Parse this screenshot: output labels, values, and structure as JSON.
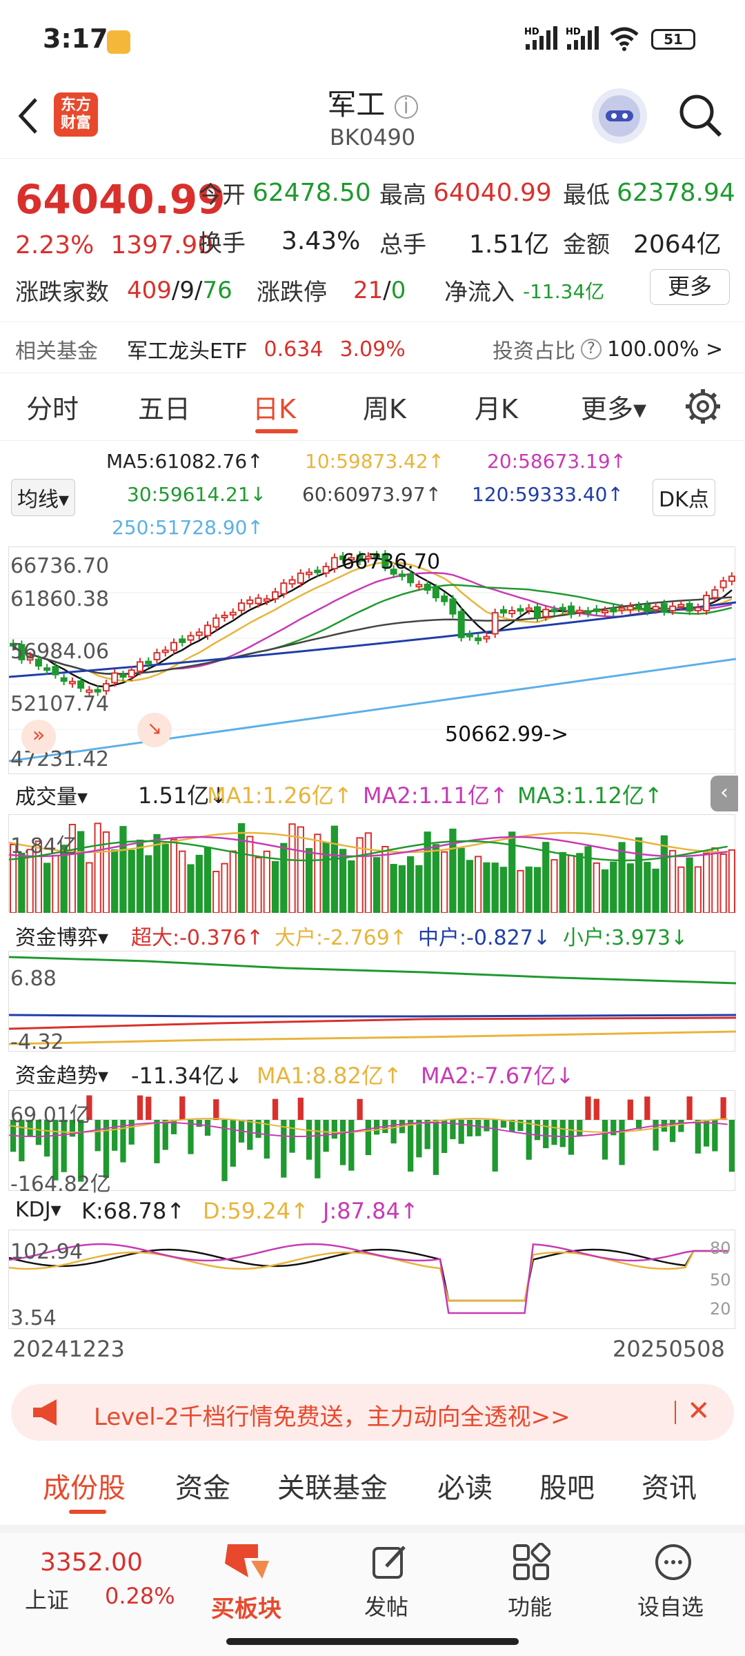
{
  "status": {
    "time": "3:17",
    "battery": "51",
    "net1": "HD",
    "net2": "HD"
  },
  "header": {
    "title": "军工",
    "code": "BK0490",
    "logo_line1": "东方",
    "logo_line2": "财富"
  },
  "quote": {
    "price": "64040.99",
    "change_pct": "2.23%",
    "change": "1397.90",
    "open_label": "今开",
    "open": "62478.50",
    "high_label": "最高",
    "high": "64040.99",
    "low_label": "最低",
    "low": "62378.94",
    "turnover_label": "换手",
    "turnover": "3.43%",
    "volume_label": "总手",
    "volume": "1.51亿",
    "amount_label": "金额",
    "amount": "2064亿",
    "advdec_label": "涨跌家数",
    "adv": "409",
    "sep1": "/",
    "flat": "9",
    "sep2": "/",
    "dec": "76",
    "limit_label": "涨跌停",
    "limit_up": "21",
    "sep3": "/",
    "limit_down": "0",
    "netflow_label": "净流入",
    "netflow": "-11.34亿",
    "more_btn": "更多"
  },
  "fund": {
    "label": "相关基金",
    "name": "军工龙头ETF",
    "price": "0.634",
    "pct": "3.09%",
    "ratio_label": "投资占比",
    "ratio": "100.00% >"
  },
  "tabs": [
    "分时",
    "五日",
    "日K",
    "周K",
    "月K",
    "更多▾"
  ],
  "ma": {
    "ma5": "MA5:61082.76↑",
    "ma10": "10:59873.42↑",
    "ma20": "20:58673.19↑",
    "ma30": "30:59614.21↓",
    "ma60": "60:60973.97↑",
    "ma120": "120:59333.40↑",
    "ma250": "250:51728.90↑",
    "junxian": "均线▾",
    "dk": "DK点"
  },
  "kline_axis": {
    "y1": "66736.70",
    "y2": "61860.38",
    "y3": "56984.06",
    "y4": "52107.74",
    "y5": "47231.42",
    "peak": "66736.70",
    "low": "50662.99->"
  },
  "vol": {
    "label": "成交量▾",
    "value": "1.51亿↓",
    "ma1": "MA1:1.26亿↑",
    "ma2": "MA2:1.11亿↑",
    "ma3": "MA3:1.12亿↑",
    "axis": "1.84亿"
  },
  "capital": {
    "label": "资金博弈▾",
    "super": "超大:-0.376↑",
    "big": "大户:-2.769↑",
    "mid": "中户:-0.827↓",
    "small": "小户:3.973↓",
    "top": "6.88",
    "bottom": "-4.32"
  },
  "trend": {
    "label": "资金趋势▾",
    "value": "-11.34亿↓",
    "ma1": "MA1:8.82亿↑",
    "ma2": "MA2:-7.67亿↓",
    "top": "69.01亿",
    "bottom": "-164.82亿"
  },
  "kdj": {
    "label": "KDJ▾",
    "k": "K:68.78↑",
    "d": "D:59.24↑",
    "j": "J:87.84↑",
    "top": "102.94",
    "bottom": "3.54",
    "r80": "80",
    "r50": "50",
    "r20": "20"
  },
  "dates": {
    "start": "20241223",
    "end": "20250508"
  },
  "banner": {
    "text": "Level-2千档行情免费送，主力动向全透视>>"
  },
  "bottom_tabs": [
    "成份股",
    "资金",
    "关联基金",
    "必读",
    "股吧",
    "资讯"
  ],
  "nav": {
    "index_value": "3352.00",
    "index_name": "上证",
    "index_pct": "0.28%",
    "buy": "买板块",
    "post": "发帖",
    "func": "功能",
    "watch": "设自选"
  },
  "colors": {
    "up": "#d9302c",
    "down": "#1e9a2e",
    "accent": "#e8492d"
  }
}
